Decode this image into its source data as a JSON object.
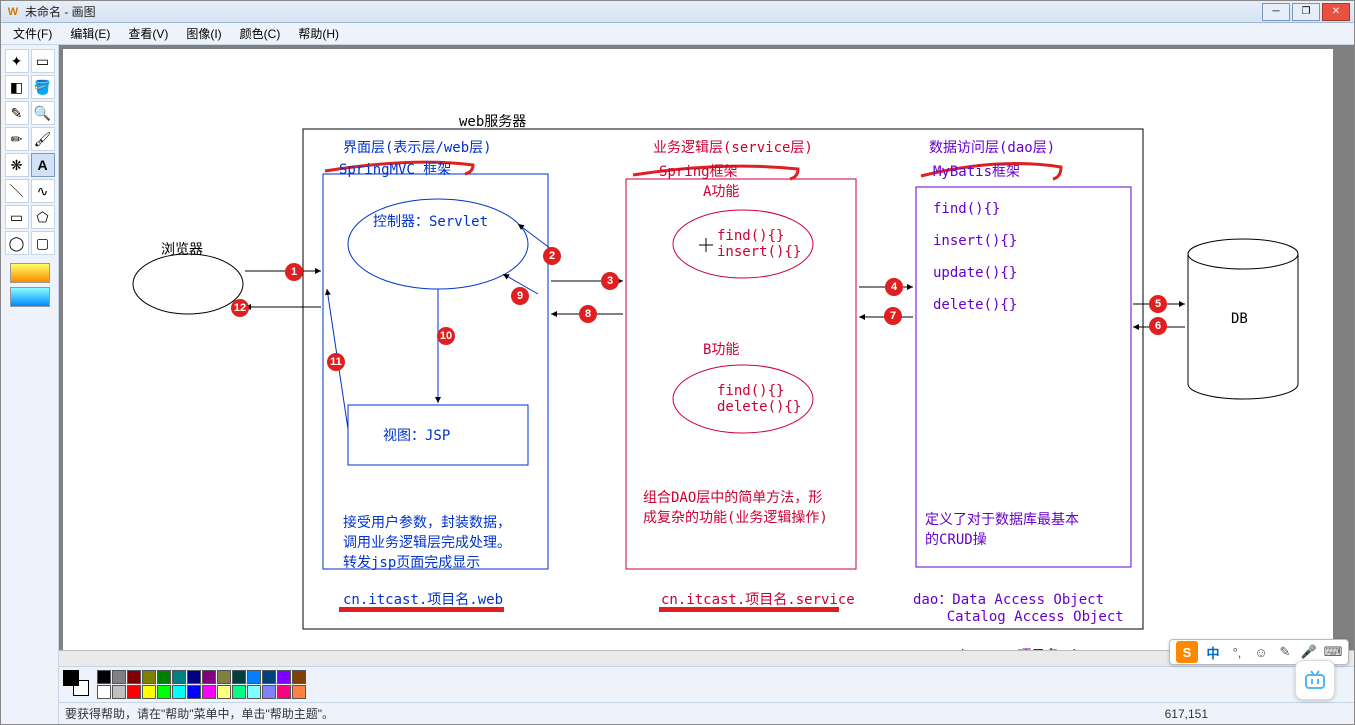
{
  "window": {
    "title": "未命名 - 画图"
  },
  "menu": {
    "file": "文件(F)",
    "edit": "编辑(E)",
    "view": "查看(V)",
    "image": "图像(I)",
    "colors": "颜色(C)",
    "help": "帮助(H)"
  },
  "status": {
    "help_text": "要获得帮助，请在\"帮助\"菜单中，单击\"帮助主题\"。",
    "coords": "617,151"
  },
  "ime": {
    "lang": "中"
  },
  "diagram": {
    "browser_label": "浏览器",
    "webserver_title": "web服务器",
    "db_label": "DB",
    "web_layer": {
      "title": "界面层(表示层/web层)",
      "framework": "SpringMVC 框架",
      "controller": "控制器：Servlet",
      "view": "视图：JSP",
      "desc": "接受用户参数，封装数据，\n调用业务逻辑层完成处理。\n转发jsp页面完成显示",
      "package": "cn.itcast.项目名.web"
    },
    "service_layer": {
      "title": "业务逻辑层(service层)",
      "framework": "Spring框架",
      "func_a": "A功能",
      "func_a_methods": "find(){}\ninsert(){}",
      "func_b": "B功能",
      "func_b_methods": "find(){}\ndelete(){}",
      "desc": "组合DAO层中的简单方法，形\n成复杂的功能(业务逻辑操作)",
      "package": "cn.itcast.项目名.service"
    },
    "dao_layer": {
      "title": "数据访问层(dao层)",
      "framework": "MyBatis框架",
      "methods": "find(){}\n\ninsert(){}\n\nupdate(){}\n\ndelete(){}",
      "desc": "定义了对于数据库最基本\n的CRUD操",
      "acronym": "dao：Data Access Object\n    Catalog Access Object",
      "package": "cn.itcast.项目名.dao"
    },
    "badges": {
      "n1": "1",
      "n2": "2",
      "n3": "3",
      "n4": "4",
      "n5": "5",
      "n6": "6",
      "n7": "7",
      "n8": "8",
      "n9": "9",
      "n10": "10",
      "n11": "11",
      "n12": "12"
    }
  },
  "palette_colors_top": [
    "#000000",
    "#808080",
    "#800000",
    "#808000",
    "#008000",
    "#008080",
    "#000080",
    "#800080",
    "#808040",
    "#004040",
    "#0080ff",
    "#004080",
    "#8000ff",
    "#804000"
  ],
  "palette_colors_bot": [
    "#ffffff",
    "#c0c0c0",
    "#ff0000",
    "#ffff00",
    "#00ff00",
    "#00ffff",
    "#0000ff",
    "#ff00ff",
    "#ffff80",
    "#00ff80",
    "#80ffff",
    "#8080ff",
    "#ff0080",
    "#ff8040"
  ]
}
